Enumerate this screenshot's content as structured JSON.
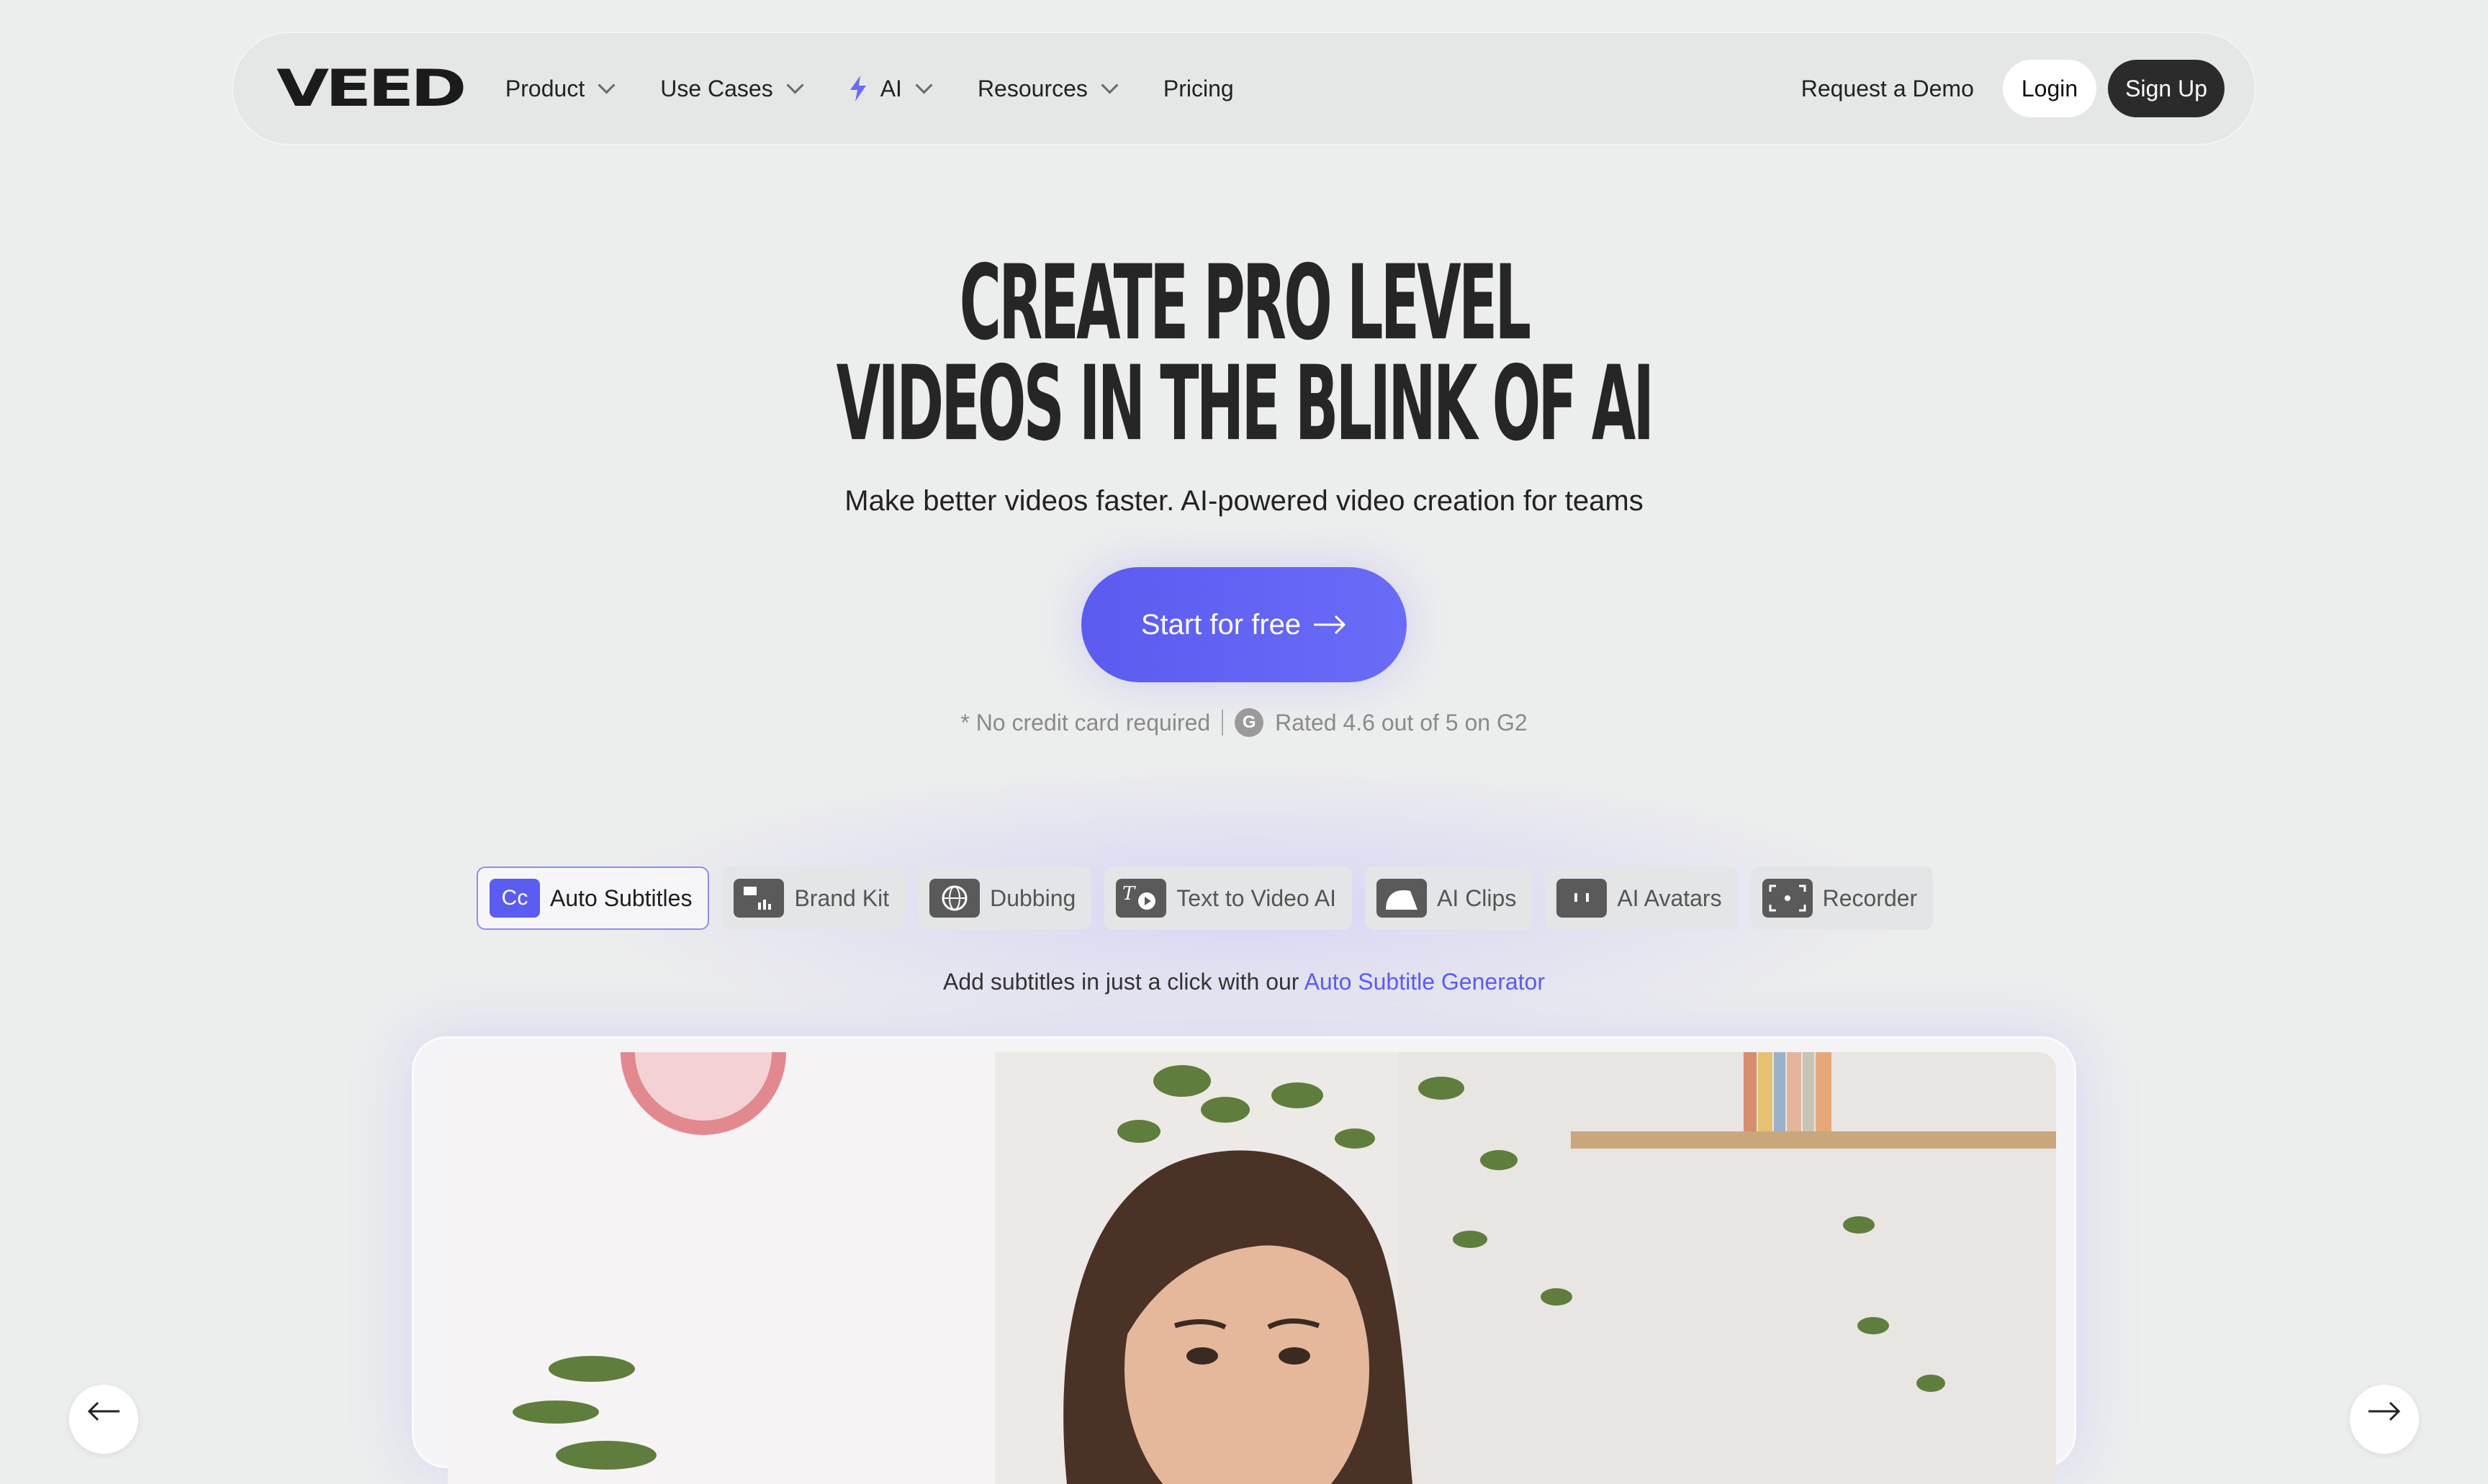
{
  "nav": {
    "logo": "VEED",
    "items": [
      {
        "label": "Product",
        "dropdown": true
      },
      {
        "label": "Use Cases",
        "dropdown": true
      },
      {
        "label": "AI",
        "dropdown": true,
        "icon": "lightning-bolt-icon"
      },
      {
        "label": "Resources",
        "dropdown": true
      },
      {
        "label": "Pricing",
        "dropdown": false
      }
    ],
    "request_demo": "Request a Demo",
    "login": "Login",
    "signup": "Sign Up"
  },
  "hero": {
    "title_line1": "CREATE PRO LEVEL",
    "title_line2": "VIDEOS IN THE BLINK OF AI",
    "subtitle": "Make better videos faster. AI-powered video creation for teams",
    "cta_label": "Start for free",
    "no_credit": "* No credit card required",
    "rating": "Rated 4.6 out of 5 on G2",
    "g2_badge": "G"
  },
  "tabs": [
    {
      "label": "Auto Subtitles",
      "icon": "cc",
      "active": true
    },
    {
      "label": "Brand Kit",
      "icon": "brand-kit-icon",
      "active": false
    },
    {
      "label": "Dubbing",
      "icon": "globe-icon",
      "active": false
    },
    {
      "label": "Text to Video AI",
      "icon": "text-video-icon",
      "active": false
    },
    {
      "label": "AI Clips",
      "icon": "clips-icon",
      "active": false
    },
    {
      "label": "AI Avatars",
      "icon": "avatar-icon",
      "active": false
    },
    {
      "label": "Recorder",
      "icon": "recorder-icon",
      "active": false
    }
  ],
  "caption": {
    "text": "Add subtitles in just a click with our ",
    "link": "Auto Subtitle Generator"
  },
  "colors": {
    "accent": "#5b5cf0",
    "background": "#eceded",
    "dark_button": "#2b2b2b"
  }
}
